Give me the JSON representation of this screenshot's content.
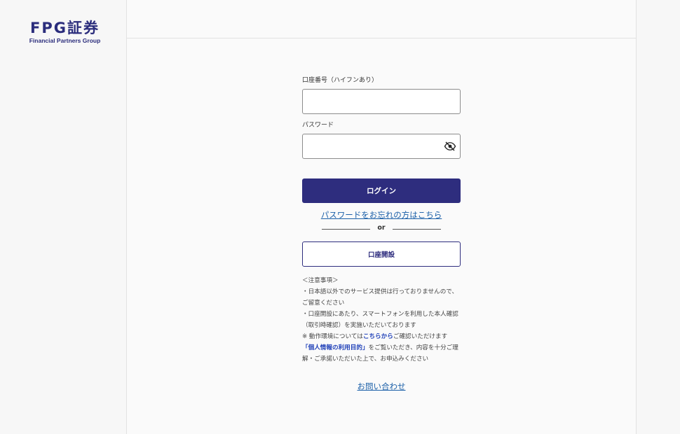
{
  "logo": {
    "main": "FPG証券",
    "sub": "Financial Partners Group"
  },
  "form": {
    "account_label": "口座番号（ハイフンあり）",
    "account_value": "",
    "password_label": "パスワード",
    "password_value": "",
    "login_label": "ログイン",
    "forgot_label": "パスワードをお忘れの方はこちら",
    "or_label": "or",
    "open_account_label": "口座開設"
  },
  "notes": {
    "heading": "＜注意事項＞",
    "line1": "・日本語以外でのサービス提供は行っておりませんので、ご留意ください",
    "line2": "・口座開設にあたり、スマートフォンを利用した本人確認（取引時確認）を実施いただいております",
    "line3_prefix": "※ 動作環境については",
    "line3_link": "こちらから",
    "line3_suffix": "ご確認いただけます",
    "line4_link": "「個人情報の利用目的」",
    "line4_suffix": "をご覧いただき、内容を十分ご理解・ご承諾いただいた上で、お申込みください"
  },
  "contact_label": "お問い合わせ",
  "icons": {
    "password_toggle": "eye-slash-icon"
  },
  "colors": {
    "brand": "#2e2d7e",
    "link": "#1a5fa8",
    "note_link": "#1e3fb8"
  }
}
